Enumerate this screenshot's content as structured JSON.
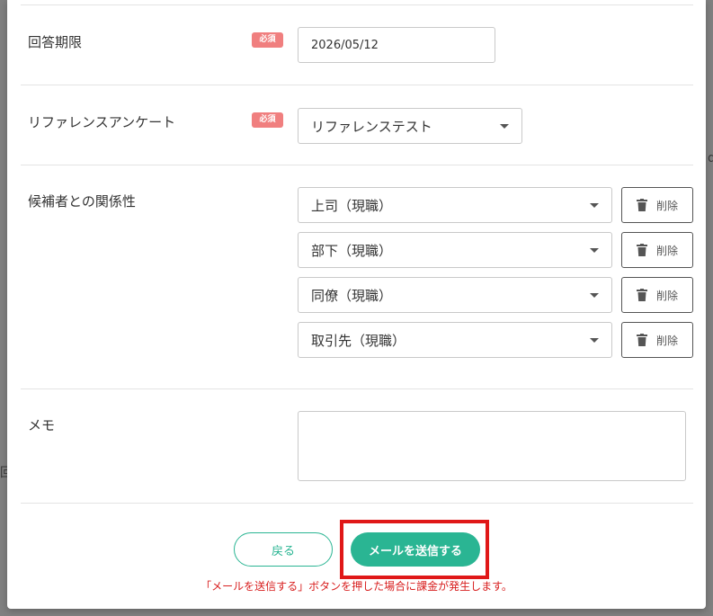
{
  "background": {
    "fragments": [
      "回",
      "d"
    ]
  },
  "form": {
    "deadline": {
      "label": "回答期限",
      "badge": "必須",
      "value": "2026/05/12"
    },
    "survey": {
      "label": "リファレンスアンケート",
      "badge": "必須",
      "selected": "リファレンステスト"
    },
    "relationship": {
      "label": "候補者との関係性",
      "delete_label": "削除",
      "items": [
        {
          "selected": "上司（現職）"
        },
        {
          "selected": "部下（現職）"
        },
        {
          "selected": "同僚（現職）"
        },
        {
          "selected": "取引先（現職）"
        }
      ]
    },
    "memo": {
      "label": "メモ",
      "value": ""
    }
  },
  "actions": {
    "back_label": "戻る",
    "send_label": "メールを送信する",
    "notice": "「メールを送信する」ボタンを押した場合に課金が発生します。"
  },
  "colors": {
    "accent": "#2ab593",
    "required_badge": "#f07f7f",
    "highlight": "#e01818",
    "notice": "#d81f1f"
  }
}
